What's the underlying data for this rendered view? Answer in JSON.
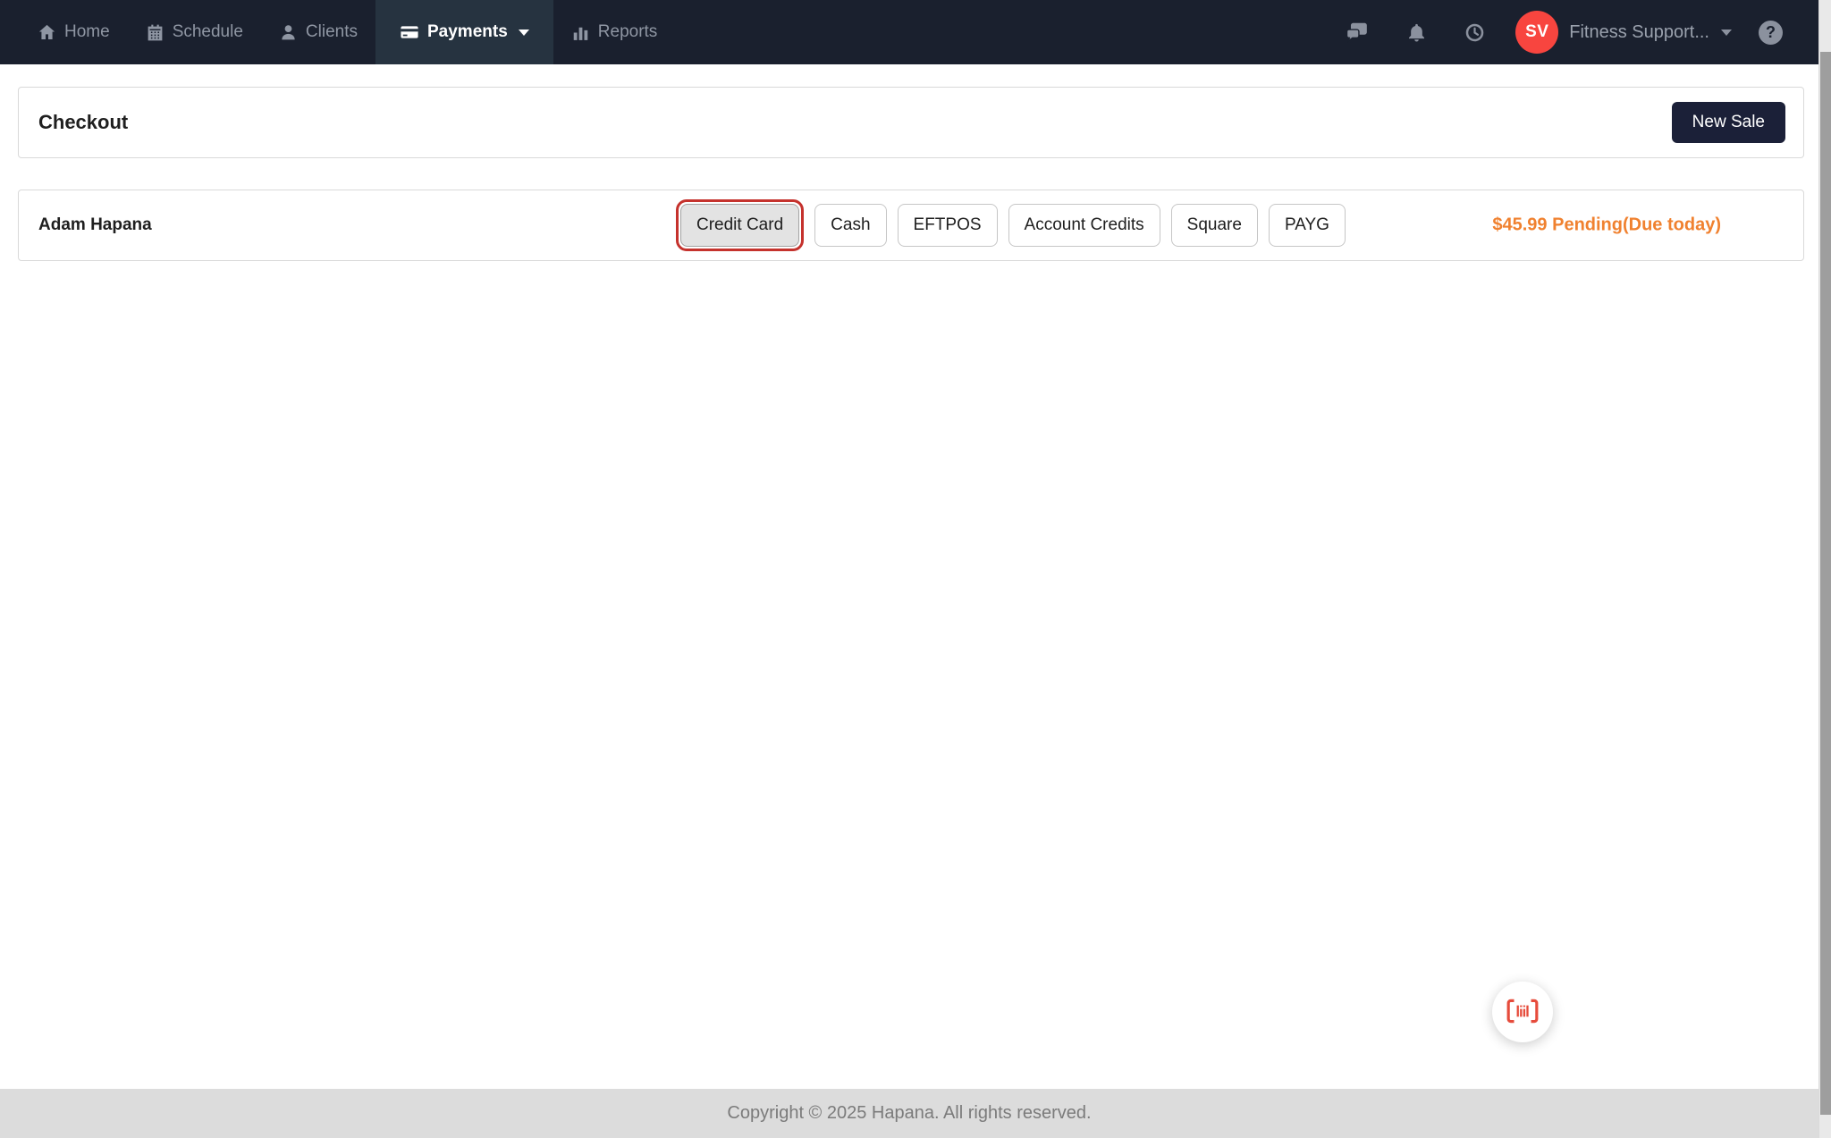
{
  "navbar": {
    "items": [
      {
        "label": "Home",
        "icon": "home-icon"
      },
      {
        "label": "Schedule",
        "icon": "calendar-icon"
      },
      {
        "label": "Clients",
        "icon": "person-icon"
      },
      {
        "label": "Payments",
        "icon": "credit-card-icon",
        "active": true,
        "has_caret": true
      },
      {
        "label": "Reports",
        "icon": "bar-chart-icon"
      }
    ],
    "right": {
      "icons": [
        "chat-icon",
        "bell-icon",
        "clock-icon"
      ],
      "avatar_initials": "SV",
      "account_name": "Fitness Support...",
      "help_label": "?"
    }
  },
  "checkout": {
    "title": "Checkout",
    "new_sale_label": "New Sale"
  },
  "sale_row": {
    "client_name": "Adam Hapana",
    "payment_methods": [
      {
        "label": "Credit Card",
        "selected": true
      },
      {
        "label": "Cash",
        "selected": false
      },
      {
        "label": "EFTPOS",
        "selected": false
      },
      {
        "label": "Account Credits",
        "selected": false
      },
      {
        "label": "Square",
        "selected": false
      },
      {
        "label": "PAYG",
        "selected": false
      }
    ],
    "amount_status": "$45.99 Pending(Due today)"
  },
  "floating_button": {
    "icon": "barcode-scanner-icon"
  },
  "footer": {
    "copyright": "Copyright © 2025 Hapana. All rights reserved."
  },
  "colors": {
    "navbar_bg": "#1a202e",
    "navbar_active_bg": "#263340",
    "avatar_bg": "#f8453f",
    "amount_orange": "#f0812f",
    "selected_ring_red": "#c5322d",
    "scan_icon_red": "#e64c3c",
    "new_sale_bg": "#1b2038",
    "footer_bg": "#dcdcdc"
  }
}
